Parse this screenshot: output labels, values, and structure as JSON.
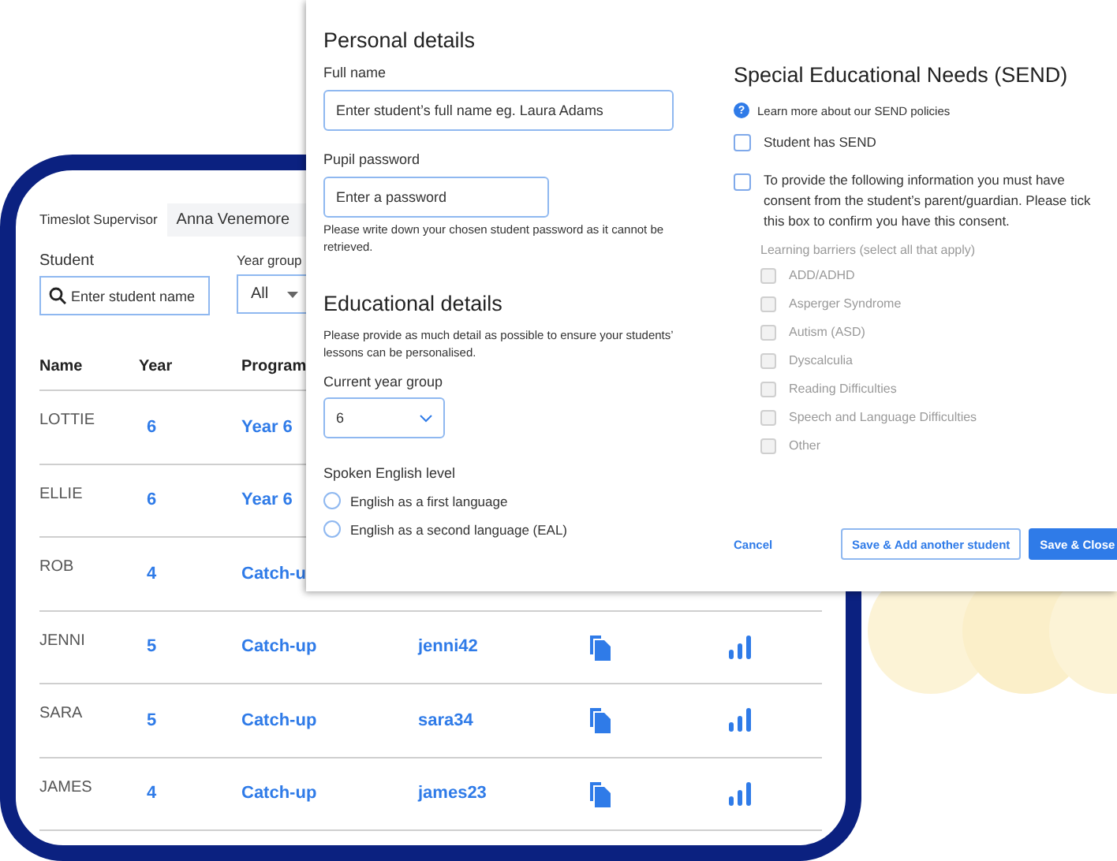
{
  "student_list": {
    "supervisor_label": "Timeslot Supervisor",
    "supervisor": "Anna Venemore",
    "student_label": "Student",
    "student_placeholder": "Enter student name",
    "year_group_label": "Year group",
    "year_group_value": "All",
    "columns": [
      "Name",
      "Year",
      "Program"
    ],
    "rows": [
      {
        "name": "LOTTIE",
        "year": "6",
        "programme": "Year 6"
      },
      {
        "name": "ELLIE",
        "year": "6",
        "programme": "Year 6"
      },
      {
        "name": "ROB",
        "year": "4",
        "programme": "Catch-u"
      },
      {
        "name": "JENNI",
        "year": "5",
        "programme": "Catch-up",
        "username": "jenni42"
      },
      {
        "name": "SARA",
        "year": "5",
        "programme": "Catch-up",
        "username": "sara34"
      },
      {
        "name": "JAMES",
        "year": "4",
        "programme": "Catch-up",
        "username": "james23"
      }
    ]
  },
  "add_student_dialog": {
    "personal": {
      "heading": "Personal details",
      "full_name_label": "Full name",
      "full_name_placeholder": "Enter student’s full name eg. Laura Adams",
      "password_label": "Pupil password",
      "password_placeholder": "Enter a password",
      "password_note": "Please write down your chosen student password as it cannot be retrieved."
    },
    "educational": {
      "heading": "Educational details",
      "note": "Please provide as much detail as possible to ensure your students’ lessons can be personalised.",
      "year_label": "Current year group",
      "year_value": "6",
      "english_label": "Spoken English level",
      "english_options": [
        {
          "label": "English as a first language",
          "selected": false
        },
        {
          "label": "English as a second language (EAL)",
          "selected": false
        }
      ]
    },
    "send": {
      "heading": "Special Educational Needs (SEND)",
      "learn_more": "Learn more about our SEND policies",
      "help_icon": "?",
      "has_send": {
        "label": "Student has SEND",
        "checked": false
      },
      "consent": {
        "label": "To provide the following information you must have consent from the student’s parent/guardian. Please tick this box to confirm you have this consent.",
        "checked": false
      },
      "barriers_label": "Learning barriers (select all that apply)",
      "barriers": [
        {
          "label": "ADD/ADHD",
          "checked": false,
          "disabled": true
        },
        {
          "label": "Asperger Syndrome",
          "checked": false,
          "disabled": true
        },
        {
          "label": "Autism (ASD)",
          "checked": false,
          "disabled": true
        },
        {
          "label": "Dyscalculia",
          "checked": false,
          "disabled": true
        },
        {
          "label": "Reading Difficulties",
          "checked": false,
          "disabled": true
        },
        {
          "label": "Speech and Language Difficulties",
          "checked": false,
          "disabled": true
        },
        {
          "label": "Other",
          "checked": false,
          "disabled": true
        }
      ]
    },
    "buttons": {
      "cancel": "Cancel",
      "save_add": "Save & Add another student",
      "save_close": "Save & Close"
    }
  }
}
